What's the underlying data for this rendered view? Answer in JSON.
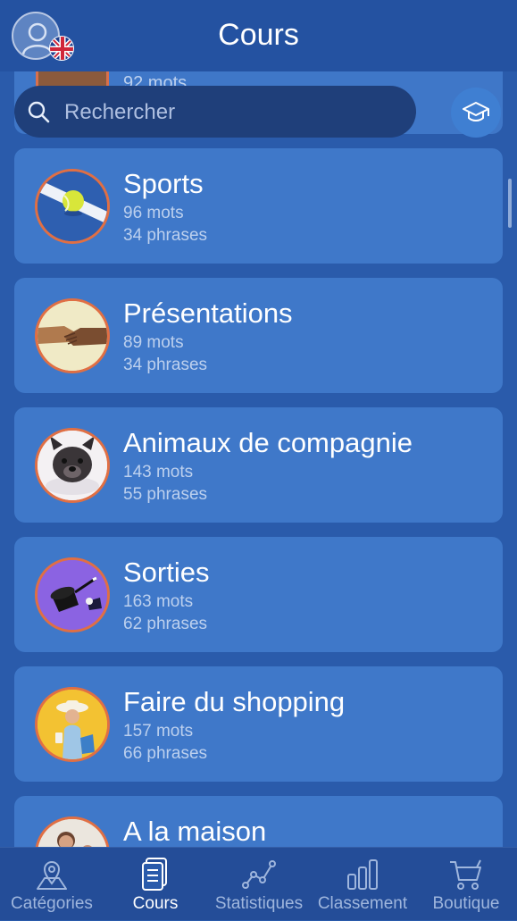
{
  "header": {
    "title": "Cours"
  },
  "partial_card": {
    "words": "92 mots"
  },
  "search": {
    "placeholder": "Rechercher"
  },
  "courses": [
    {
      "title": "Sports",
      "words": "96 mots",
      "phrases": "34 phrases",
      "icon": "tennis-ball-icon"
    },
    {
      "title": "Présentations",
      "words": "89 mots",
      "phrases": "34 phrases",
      "icon": "handshake-icon"
    },
    {
      "title": "Animaux de compagnie",
      "words": "143 mots",
      "phrases": "55 phrases",
      "icon": "dog-icon"
    },
    {
      "title": "Sorties",
      "words": "163 mots",
      "phrases": "62 phrases",
      "icon": "magic-hat-icon"
    },
    {
      "title": "Faire du shopping",
      "words": "157 mots",
      "phrases": "66 phrases",
      "icon": "shopper-icon"
    },
    {
      "title": "A la maison",
      "icon": "family-icon"
    }
  ],
  "tabs": [
    {
      "label": "Catégories",
      "icon": "map-pin-icon",
      "active": false
    },
    {
      "label": "Cours",
      "icon": "cards-icon",
      "active": true
    },
    {
      "label": "Statistiques",
      "icon": "line-chart-icon",
      "active": false
    },
    {
      "label": "Classement",
      "icon": "bar-chart-icon",
      "active": false
    },
    {
      "label": "Boutique",
      "icon": "cart-icon",
      "active": false
    }
  ],
  "colors": {
    "background": "#2a5bab",
    "card": "#3f78c9",
    "accent_ring": "#e06f44",
    "subtext": "#bcd0ee"
  }
}
